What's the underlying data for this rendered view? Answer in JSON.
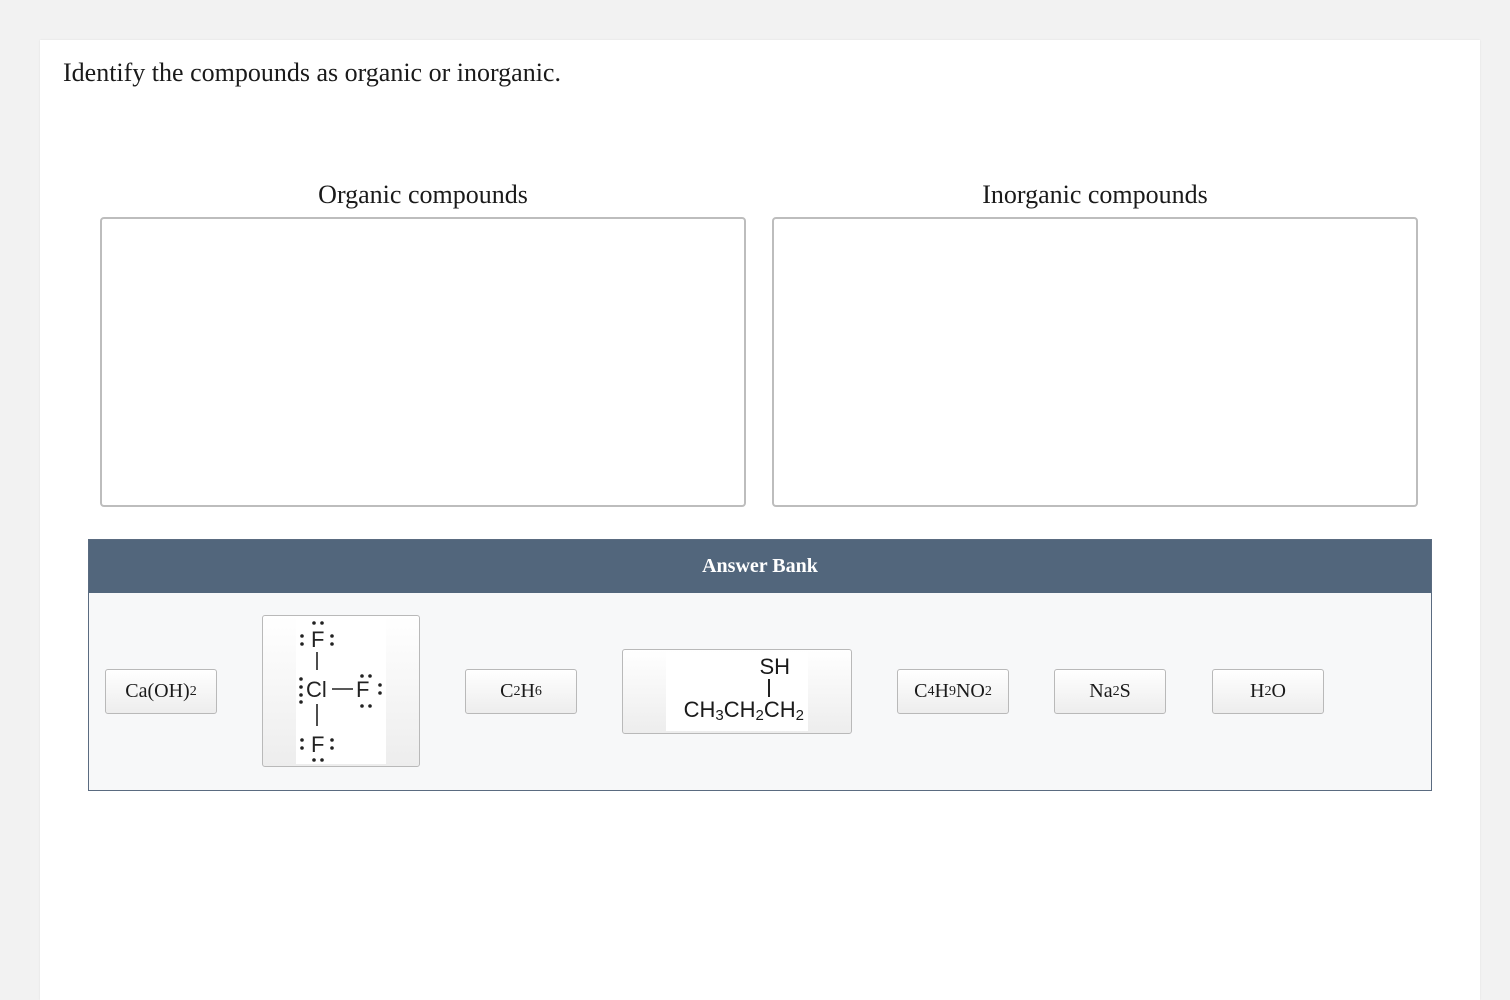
{
  "prompt": "Identify the compounds as organic or inorganic.",
  "bins": {
    "organic_label": "Organic compounds",
    "inorganic_label": "Inorganic compounds"
  },
  "answer_bank": {
    "title": "Answer Bank",
    "items": [
      {
        "base": "Ca(OH)",
        "sub": "2"
      },
      {
        "structure": "ClF3",
        "atoms": {
          "top": "F",
          "center": "Cl",
          "right": "F",
          "bottom": "F"
        }
      },
      {
        "parts": [
          "C",
          "2",
          "H",
          "6"
        ]
      },
      {
        "structure": "propanethiol",
        "top": "SH",
        "bond": "|",
        "chain": "CH3CH2CH2"
      },
      {
        "parts": [
          "C",
          "4",
          "H",
          "9",
          "NO",
          "2"
        ]
      },
      {
        "parts": [
          "Na",
          "2",
          "S"
        ]
      },
      {
        "parts": [
          "H",
          "2",
          "O"
        ]
      }
    ]
  }
}
